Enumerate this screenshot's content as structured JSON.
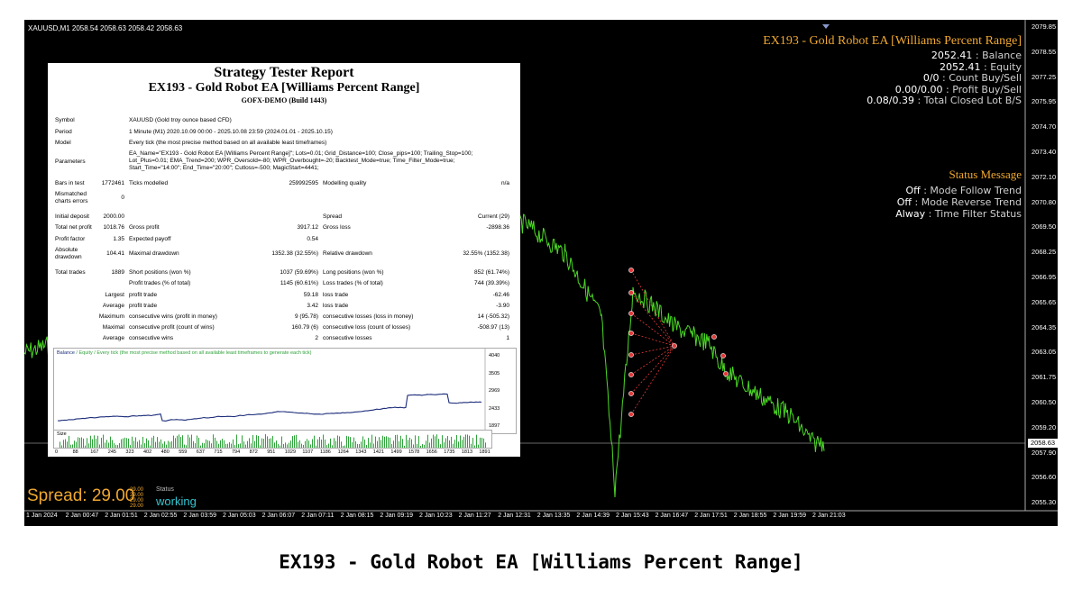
{
  "header": {
    "symbol_line": "XAUUSD,M1  2058.54 2058.63 2058.42 2058.63"
  },
  "ea_panel": {
    "title": "EX193 - Gold Robot EA [Williams Percent Range]",
    "rows": [
      {
        "value": "2052.41",
        "label": "Balance"
      },
      {
        "value": "2052.41",
        "label": "Equity"
      },
      {
        "value": "0/0",
        "label": "Count Buy/Sell"
      },
      {
        "value": "0.00/0.00",
        "label": "Profit Buy/Sell"
      },
      {
        "value": "0.08/0.39",
        "label": "Total Closed Lot B/S"
      }
    ],
    "separator": " : "
  },
  "status_panel": {
    "title": "Status Message",
    "rows": [
      {
        "value": "Off",
        "label": "Mode Follow Trend"
      },
      {
        "value": "Off",
        "label": "Mode Reverse Trend"
      },
      {
        "value": "Alway",
        "label": "Time Filter Status"
      }
    ]
  },
  "spread": {
    "label": "Spread: 29.00",
    "mini": [
      "29.00",
      "29.00",
      "29.00",
      "29.00"
    ],
    "status_label": "Status",
    "status_value": "working"
  },
  "y_axis": [
    "2079.85",
    "2078.55",
    "2077.25",
    "2075.95",
    "2074.70",
    "2073.40",
    "2072.10",
    "2070.80",
    "2069.50",
    "2068.25",
    "2066.95",
    "2065.65",
    "2064.35",
    "2063.05",
    "2061.75",
    "2060.50",
    "2059.20",
    "2057.90",
    "2056.60",
    "2055.30"
  ],
  "current_price": "2058.63",
  "x_axis": [
    "1 Jan 2024",
    "2 Jan 00:47",
    "2 Jan 01:51",
    "2 Jan 02:55",
    "2 Jan 03:59",
    "2 Jan 05:03",
    "2 Jan 06:07",
    "2 Jan 07:11",
    "2 Jan 08:15",
    "2 Jan 09:19",
    "2 Jan 10:23",
    "2 Jan 11:27",
    "2 Jan 12:31",
    "2 Jan 13:35",
    "2 Jan 14:39",
    "2 Jan 15:43",
    "2 Jan 16:47",
    "2 Jan 17:51",
    "2 Jan 18:55",
    "2 Jan 19:59",
    "2 Jan 21:03"
  ],
  "report": {
    "title": "Strategy Tester Report",
    "subtitle": "EX193 - Gold Robot EA [Williams Percent Range]",
    "build": "GOFX-DEMO (Build 1443)",
    "symbol_label": "Symbol",
    "symbol_value": "XAUUSD (Gold troy ounce based CFD)",
    "period_label": "Period",
    "period_value": "1 Minute (M1) 2020.10.09 00:00 - 2025.10.08 23:59 (2024.01.01 - 2025.10.15)",
    "model_label": "Model",
    "model_value": "Every tick (the most precise method based on all available least timeframes)",
    "params_label": "Parameters",
    "params_value": "EA_Name=\"EX193 - Gold Robot EA [Williams Percent Range]\"; Lots=0.01; Grid_Distance=100; Close_pips=100; Trailing_Stop=100; Lot_Plus=0.01; EMA_Trend=200; WPR_Oversold=-80; WPR_Overbought=-20; Backtest_Mode=true; Time_Filter_Mode=true; Start_Time=\"14:00\"; End_Time=\"20:00\"; Cutloss=-500; MagicStart=4441;",
    "bars_label": "Bars in test",
    "bars_value": "1772461",
    "ticks_label": "Ticks modelled",
    "ticks_value": "259992595",
    "mq_label": "Modelling quality",
    "mq_value": "n/a",
    "mismatch_label": "Mismatched charts errors",
    "mismatch_value": "0",
    "deposit_label": "Initial deposit",
    "deposit_value": "2000.00",
    "spread_label": "Spread",
    "spread_value": "Current (29)",
    "tnp_label": "Total net profit",
    "tnp_value": "1018.76",
    "gp_label": "Gross profit",
    "gp_value": "3917.12",
    "gl_label": "Gross loss",
    "gl_value": "-2898.36",
    "pf_label": "Profit factor",
    "pf_value": "1.35",
    "ep_label": "Expected payoff",
    "ep_value": "0.54",
    "ad_label": "Absolute drawdown",
    "ad_value": "104.41",
    "md_label": "Maximal drawdown",
    "md_value": "1352.38 (32.55%)",
    "rd_label": "Relative drawdown",
    "rd_value": "32.55% (1352.38)",
    "tt_label": "Total trades",
    "tt_value": "1889",
    "sp_label": "Short positions (won %)",
    "sp_value": "1037 (59.69%)",
    "lp_label": "Long positions (won %)",
    "lp_value": "852 (61.74%)",
    "ptr_label": "Profit trades (% of total)",
    "ptr_value": "1145 (60.61%)",
    "ltr_label": "Loss trades (% of total)",
    "ltr_value": "744 (39.39%)",
    "largest_label": "Largest",
    "lpt_label": "profit trade",
    "lpt_value": "59.18",
    "llt_label": "loss trade",
    "llt_value": "-62.46",
    "average_label": "Average",
    "apt_label": "profit trade",
    "apt_value": "3.42",
    "alt_label": "loss trade",
    "alt_value": "-3.90",
    "maximum_label": "Maximum",
    "mcw_label": "consecutive wins (profit in money)",
    "mcw_value": "9 (95.78)",
    "mcl_label": "consecutive losses (loss in money)",
    "mcl_value": "14 (-505.32)",
    "maximal_label": "Maximal",
    "mcp_label": "consecutive profit (count of wins)",
    "mcp_value": "160.79 (6)",
    "mclc_label": "consecutive loss (count of losses)",
    "mclc_value": "-508.97 (13)",
    "average2_label": "Average",
    "acw_label": "consecutive wins",
    "acw_value": "2",
    "acl_label": "consecutive losses",
    "acl_value": "1",
    "balance_chart_legend_balance": "Balance",
    "balance_chart_legend_rest": " / Equity / Every tick (the most precise method based on all available least timeframes to generate each tick)",
    "balance_y": [
      "4040",
      "3505",
      "2969",
      "2433",
      "1897"
    ],
    "size_label": "Size",
    "size_x": [
      "0",
      "88",
      "167",
      "245",
      "323",
      "402",
      "480",
      "559",
      "637",
      "715",
      "794",
      "872",
      "951",
      "1029",
      "1107",
      "1186",
      "1264",
      "1343",
      "1421",
      "1499",
      "1578",
      "1656",
      "1735",
      "1813",
      "1891"
    ]
  },
  "caption": "EX193 - Gold Robot EA [Williams Percent Range]",
  "colors": {
    "price": "#4cd926",
    "accent": "#f0a830",
    "balance": "#1c2d7a",
    "equity": "#2fa23b",
    "working": "#34c6d1"
  }
}
